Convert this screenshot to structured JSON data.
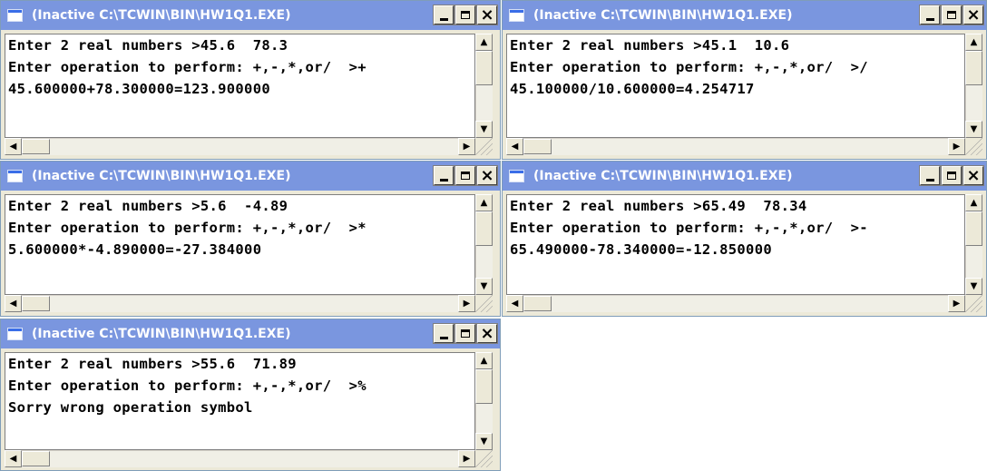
{
  "colors": {
    "titlebar": "#7a96df",
    "title_text": "#ffffff",
    "frame": "#ece9d8",
    "console_bg": "#ffffff"
  },
  "windows": [
    {
      "title": "(Inactive C:\\TCWIN\\BIN\\HW1Q1.EXE)",
      "lines": [
        "Enter 2 real numbers >45.6  78.3",
        "Enter operation to perform: +,-,*,or/  >+",
        "45.600000+78.300000=123.900000"
      ],
      "buttons": {
        "minimize": "minimize-icon",
        "maximize": "maximize-icon",
        "close": "×"
      }
    },
    {
      "title": "(Inactive C:\\TCWIN\\BIN\\HW1Q1.EXE)",
      "lines": [
        "Enter 2 real numbers >45.1  10.6",
        "Enter operation to perform: +,-,*,or/  >/",
        "45.100000/10.600000=4.254717"
      ],
      "buttons": {
        "minimize": "minimize-icon",
        "maximize": "maximize-icon",
        "close": "×"
      }
    },
    {
      "title": "(Inactive C:\\TCWIN\\BIN\\HW1Q1.EXE)",
      "lines": [
        "Enter 2 real numbers >5.6  -4.89",
        "Enter operation to perform: +,-,*,or/  >*",
        "5.600000*-4.890000=-27.384000"
      ],
      "buttons": {
        "minimize": "minimize-icon",
        "maximize": "maximize-icon",
        "close": "×"
      }
    },
    {
      "title": "(Inactive C:\\TCWIN\\BIN\\HW1Q1.EXE)",
      "lines": [
        "Enter 2 real numbers >65.49  78.34",
        "Enter operation to perform: +,-,*,or/  >-",
        "65.490000-78.340000=-12.850000"
      ],
      "buttons": {
        "minimize": "minimize-icon",
        "maximize": "maximize-icon",
        "close": "×"
      }
    },
    {
      "title": "(Inactive C:\\TCWIN\\BIN\\HW1Q1.EXE)",
      "lines": [
        "Enter 2 real numbers >55.6  71.89",
        "Enter operation to perform: +,-,*,or/  >%",
        "Sorry wrong operation symbol"
      ],
      "buttons": {
        "minimize": "minimize-icon",
        "maximize": "maximize-icon",
        "close": "×"
      }
    }
  ],
  "scroll_glyphs": {
    "up": "▲",
    "down": "▼",
    "left": "◀",
    "right": "▶"
  }
}
